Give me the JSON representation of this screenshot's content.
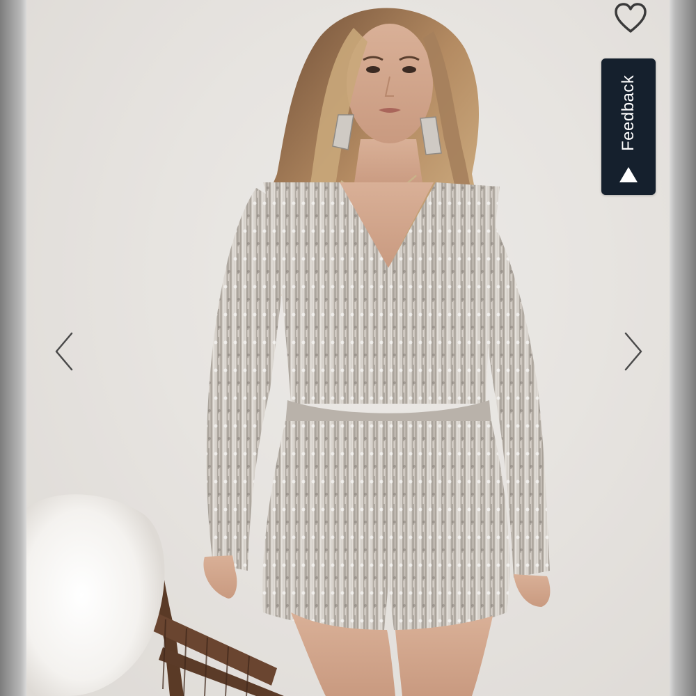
{
  "feedback": {
    "label": "Feedback"
  },
  "icons": {
    "favorite": "heart-icon",
    "previous": "chevron-left-icon",
    "next": "chevron-right-icon",
    "feedback_arrow": "triangle-up-icon"
  },
  "colors": {
    "feedback_background": "#15202d",
    "feedback_text": "#ffffff",
    "icon_stroke": "#3a3a3a"
  }
}
